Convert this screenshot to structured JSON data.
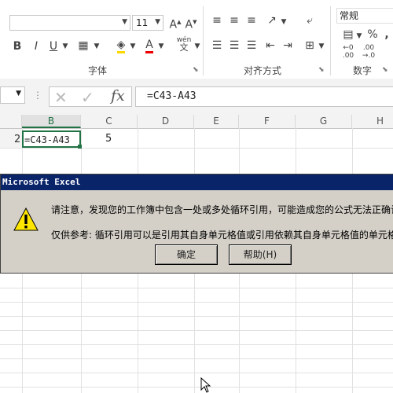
{
  "ribbon": {
    "font_size": "11",
    "number_format": "常规",
    "bold": "B",
    "italic": "I",
    "underline": "U",
    "font_color_letter": "A",
    "wen": "wén",
    "groups": {
      "font": "字体",
      "alignment": "对齐方式",
      "number": "数字"
    }
  },
  "formula_bar": {
    "formula": "=C43-A43",
    "fx": "fx"
  },
  "columns": [
    "B",
    "C",
    "D",
    "E",
    "F",
    "G",
    "H"
  ],
  "rows": [
    {
      "header": "2",
      "b": "=C43-A43",
      "c": "5"
    }
  ],
  "dialog": {
    "title": "Microsoft Excel",
    "message": "请注意，发现您的工作簿中包含一处或多处循环引用，可能造成您的公式无法正确计",
    "hint": "仅供参考: 循环引用可以是引用其自身单元格值或引用依赖其自身单元格值的单元格",
    "ok_label": "确定",
    "help_label": "帮助(H)"
  },
  "colors": {
    "accent_green": "#217346",
    "title_bar": "#0a246a",
    "dialog_bg": "#d4d0c8"
  }
}
